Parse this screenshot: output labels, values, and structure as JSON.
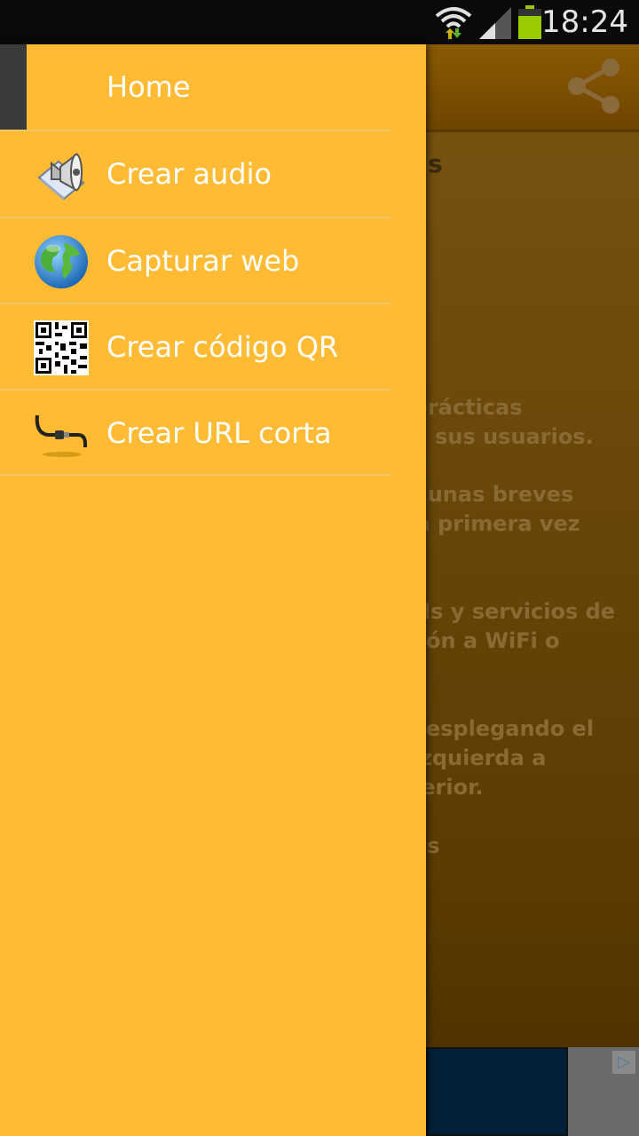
{
  "status_bar": {
    "time": "18:24",
    "battery_color": "#99cc00"
  },
  "drawer": {
    "header": "Home",
    "items": [
      {
        "label": "Crear audio",
        "icon": "megaphone-icon"
      },
      {
        "label": "Capturar web",
        "icon": "globe-icon"
      },
      {
        "label": "Crear código QR",
        "icon": "qr-code-icon"
      },
      {
        "label": "Crear URL corta",
        "icon": "cable-plug-icon"
      }
    ]
  },
  "background": {
    "heading_fragment": "s",
    "paragraph_1": "e prácticas\nd a sus usuarios.",
    "paragraph_2": "en unas breves\nr la primera vez",
    "paragraph_3": "APIs y servicios de\nexión a WiFi o",
    "paragraph_4": "s desplegando el\ne izquierda a\nuperior.",
    "paragraph_5": "más\nes."
  },
  "colors": {
    "drawer_bg": "#ffbb33",
    "accent_text": "#ffffff"
  }
}
